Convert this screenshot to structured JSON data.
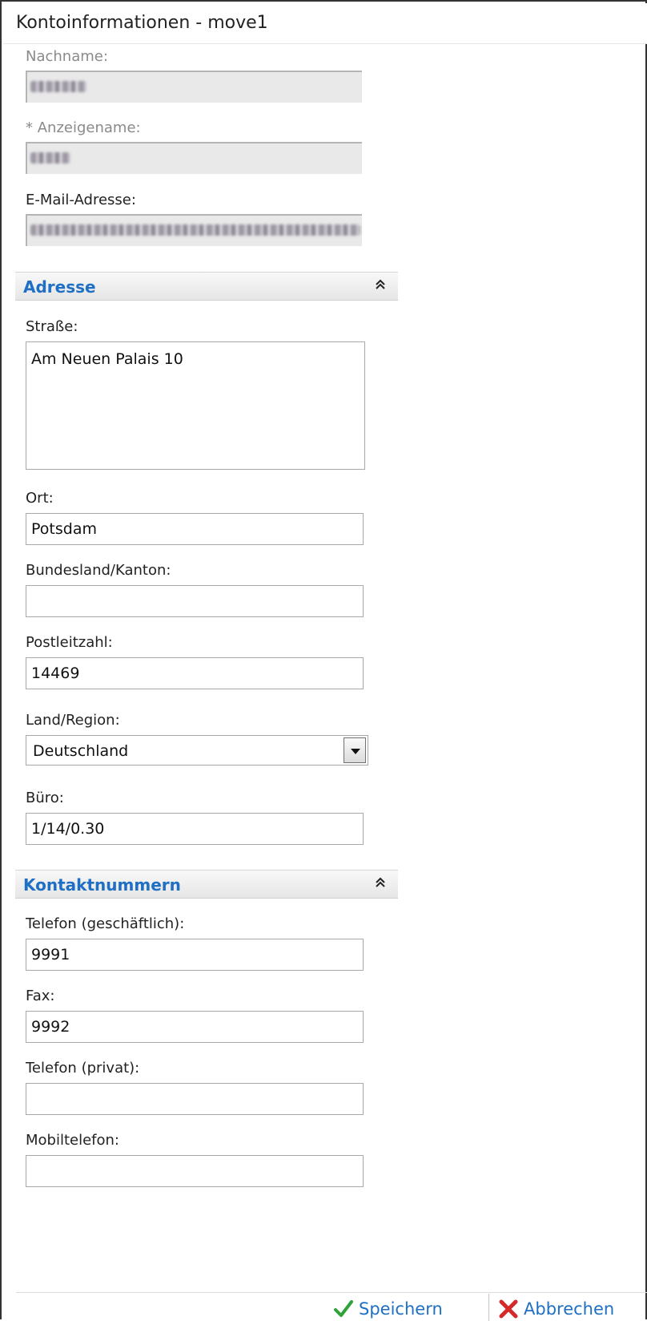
{
  "window": {
    "title": "Kontoinformationen - move1"
  },
  "account": {
    "nachname_label": "Nachname:",
    "anzeigename_label": "* Anzeigename:",
    "email_label": "E-Mail-Adresse:"
  },
  "address_section": {
    "title": "Adresse",
    "collapse_icon": "chevron-double-up",
    "strasse_label": "Straße:",
    "strasse_value": "Am Neuen Palais 10",
    "ort_label": "Ort:",
    "ort_value": "Potsdam",
    "bundesland_label": "Bundesland/Kanton:",
    "bundesland_value": "",
    "plz_label": "Postleitzahl:",
    "plz_value": "14469",
    "land_label": "Land/Region:",
    "land_value": "Deutschland",
    "buero_label": "Büro:",
    "buero_value": "1/14/0.30"
  },
  "contact_section": {
    "title": "Kontaktnummern",
    "collapse_icon": "chevron-double-up",
    "tel_business_label": "Telefon (geschäftlich):",
    "tel_business_value": "9991",
    "fax_label": "Fax:",
    "fax_value": "9992",
    "tel_private_label": "Telefon (privat):",
    "tel_private_value": "",
    "mobile_label": "Mobiltelefon:",
    "mobile_value": ""
  },
  "footer": {
    "save_label": "Speichern",
    "cancel_label": "Abbrechen",
    "save_color": "#2fa33a",
    "cancel_color": "#d42a2a",
    "link_color": "#1f6fc4"
  }
}
